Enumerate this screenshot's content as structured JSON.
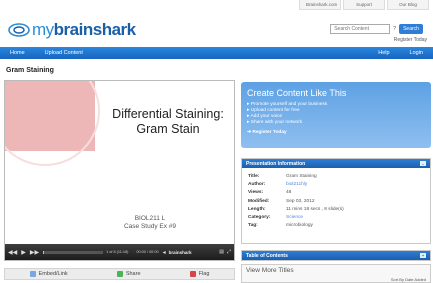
{
  "toplinks": [
    "Brainshark.com",
    "Support",
    "Our Blog"
  ],
  "logo": {
    "my": "my",
    "brand": "brainshark"
  },
  "search": {
    "placeholder": "Search Content",
    "help": "?",
    "button": "Search"
  },
  "register_top": "Register Today",
  "nav": {
    "left": [
      "Home",
      "Upload Content"
    ],
    "right": [
      "Help",
      "Login"
    ]
  },
  "page_title": "Gram Staining",
  "slide": {
    "title_line1": "Differential Staining:",
    "title_line2": "Gram Stain",
    "sub_line1": "BIOL211 L",
    "sub_line2": "Case Study Ex #9"
  },
  "player": {
    "slide_position": "1 of 8 (11:18)",
    "time": "00:00 / 00:00",
    "mini_logo": "brainshark",
    "progress": 0.02
  },
  "share": [
    {
      "label": "Embed/Link",
      "color": "#7aa7e0"
    },
    {
      "label": "Share",
      "color": "#4bb35a"
    },
    {
      "label": "Flag",
      "color": "#d94444"
    }
  ],
  "promo": {
    "title": "Create Content Like This",
    "items": [
      "Promote yourself and your business",
      "Upload content for free",
      "Add your voice",
      "Share with your network"
    ],
    "cta": "Register Today"
  },
  "info": {
    "header": "Presentation Information",
    "rows": [
      {
        "k": "Title:",
        "v": "Gram Staining",
        "link": false
      },
      {
        "k": "Author:",
        "v": "biol211hly",
        "link": true
      },
      {
        "k": "Views:",
        "v": "48",
        "link": false
      },
      {
        "k": "Modified:",
        "v": "Sep 03, 2012",
        "link": false
      },
      {
        "k": "Length:",
        "v": "11 mins 18 secs , 8 slide(s)",
        "link": false
      },
      {
        "k": "Category:",
        "v": "Science",
        "link": true
      },
      {
        "k": "Tag:",
        "v": "microbiology",
        "link": false
      }
    ]
  },
  "toc": {
    "header": "Table of Contents"
  },
  "more": {
    "title": "View More Titles",
    "sort": "Sort By Date Added"
  },
  "colors": {
    "nav": "#1f70cc",
    "promo": "#6eaae8",
    "panel_head": "#2d7ed4"
  }
}
